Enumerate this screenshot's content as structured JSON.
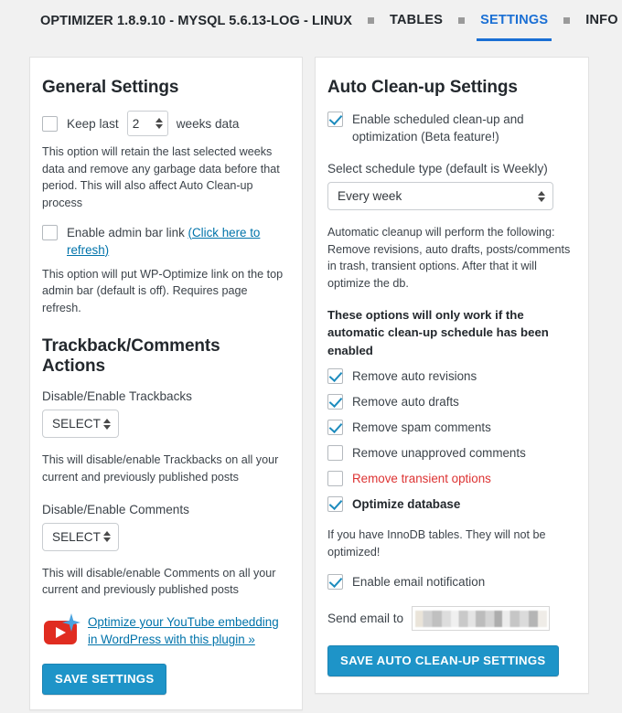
{
  "header": {
    "app_title": "OPTIMIZER 1.8.9.10 - MYSQL 5.6.13-LOG - LINUX",
    "separator": "nav-separator-square",
    "tabs": [
      {
        "label": "TABLES",
        "active": false
      },
      {
        "label": "SETTINGS",
        "active": true
      },
      {
        "label": "INFO",
        "active": false
      }
    ],
    "active_tab_color": "#1a6fd4"
  },
  "general": {
    "title": "General Settings",
    "keep_last": {
      "checked": false,
      "prefix": "Keep last",
      "value": "2",
      "suffix": "weeks data",
      "description": "This option will retain the last selected weeks data and remove any garbage data before that period. This will also affect Auto Clean-up process"
    },
    "admin_bar": {
      "checked": false,
      "label": "Enable admin bar link ",
      "link": "(Click here to refresh)",
      "description": "This option will put WP-Optimize link on the top admin bar (default is off). Requires page refresh."
    }
  },
  "trackback": {
    "title": "Trackback/Comments Actions",
    "trackbacks_label": "Disable/Enable Trackbacks",
    "trackbacks_value": "SELECT",
    "trackbacks_description": "This will disable/enable Trackbacks on all your current and previously published posts",
    "comments_label": "Disable/Enable Comments",
    "comments_value": "SELECT",
    "comments_description": "This will disable/enable Comments on all your current and previously published posts",
    "promo_link": "Optimize your YouTube embedding in WordPress with this plugin »",
    "promo_icon": "youtube-icon",
    "save_label": "SAVE SETTINGS"
  },
  "autoclean": {
    "title": "Auto Clean-up Settings",
    "enable_schedule": {
      "checked": true,
      "label": "Enable scheduled clean-up and optimization (Beta feature!)"
    },
    "schedule_label": "Select schedule type (default is Weekly)",
    "schedule_value": "Every week",
    "info_text": "Automatic cleanup will perform the following: Remove revisions, auto drafts, posts/comments in trash, transient options. After that it will optimize the db.",
    "warning_text": "These options will only work if the automatic clean-up schedule has been enabled",
    "options": [
      {
        "label": "Remove auto revisions",
        "checked": true,
        "style": "normal"
      },
      {
        "label": "Remove auto drafts",
        "checked": true,
        "style": "normal"
      },
      {
        "label": "Remove spam comments",
        "checked": true,
        "style": "normal"
      },
      {
        "label": "Remove unapproved comments",
        "checked": false,
        "style": "normal"
      },
      {
        "label": "Remove transient options",
        "checked": false,
        "style": "red"
      },
      {
        "label": "Optimize database",
        "checked": true,
        "style": "bold"
      }
    ],
    "innodb_note": "If you have InnoDB tables. They will not be optimized!",
    "email_notification": {
      "checked": true,
      "label": "Enable email notification"
    },
    "send_email_label": "Send email to",
    "send_email_value": "",
    "save_label": "SAVE AUTO CLEAN-UP SETTINGS"
  },
  "colors": {
    "page_background": "#f1f1f1",
    "panel_background": "#ffffff",
    "accent_button": "#1e94c8",
    "link": "#0073aa",
    "checkmark": "#1e8cbe",
    "danger_text": "#dd3333",
    "active_tab": "#1a6fd4"
  }
}
